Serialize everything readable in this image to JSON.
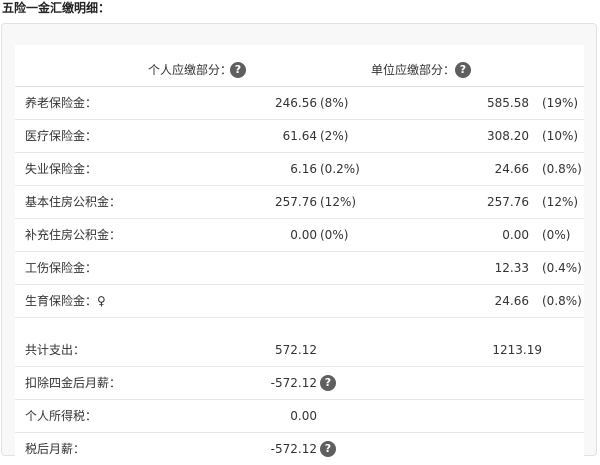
{
  "page_title": "五险一金汇缴明细：",
  "header": {
    "personal_label": "个人应缴部分：",
    "company_label": "单位应缴部分：",
    "help_glyph": "?"
  },
  "rows": [
    {
      "label": "养老保险金：",
      "personal_value": "246.56",
      "personal_pct": "(8%)",
      "company_value": "585.58",
      "company_pct": "(19%)"
    },
    {
      "label": "医疗保险金：",
      "personal_value": "61.64",
      "personal_pct": "(2%)",
      "company_value": "308.20",
      "company_pct": "(10%)"
    },
    {
      "label": "失业保险金：",
      "personal_value": "6.16",
      "personal_pct": "(0.2%)",
      "company_value": "24.66",
      "company_pct": "(0.8%)"
    },
    {
      "label": "基本住房公积金：",
      "personal_value": "257.76",
      "personal_pct": "(12%)",
      "company_value": "257.76",
      "company_pct": "(12%)"
    },
    {
      "label": "补充住房公积金：",
      "personal_value": "0.00",
      "personal_pct": "(0%)",
      "company_value": "0.00",
      "company_pct": "(0%)"
    },
    {
      "label": "工伤保险金：",
      "personal_value": "",
      "personal_pct": "",
      "company_value": "12.33",
      "company_pct": "(0.4%)"
    },
    {
      "label": "生育保险金：♀",
      "personal_value": "",
      "personal_pct": "",
      "company_value": "24.66",
      "company_pct": "(0.8%)"
    }
  ],
  "summary": {
    "total_label": "共计支出：",
    "total_personal": "572.12",
    "total_company": "1213.19",
    "after_deduction_label": "扣除四金后月薪：",
    "after_deduction_value": "-572.12",
    "income_tax_label": "个人所得税：",
    "income_tax_value": "0.00",
    "net_salary_label": "税后月薪：",
    "net_salary_value": "-572.12"
  },
  "icons": {
    "help": "help-icon",
    "help_color": "#5f5f5f"
  }
}
